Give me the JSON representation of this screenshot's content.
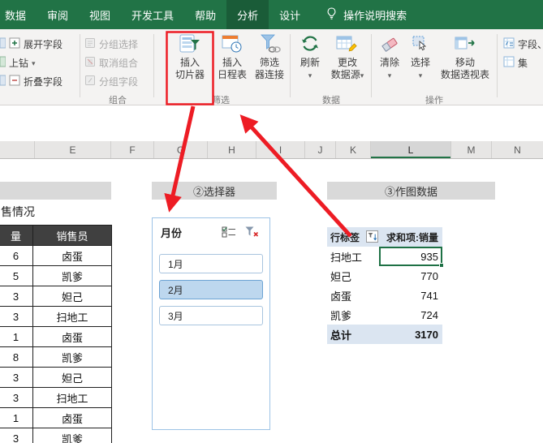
{
  "colors": {
    "excel_green": "#217346",
    "annotation_red": "#ED1C24",
    "slicer_selected_fill": "#BDD7EE",
    "pivot_header_fill": "#DBE5F1"
  },
  "topbar": {
    "tabs": [
      {
        "label": "数据"
      },
      {
        "label": "审阅"
      },
      {
        "label": "视图"
      },
      {
        "label": "开发工具"
      },
      {
        "label": "帮助"
      },
      {
        "label": "分析"
      },
      {
        "label": "设计"
      }
    ],
    "active_tab": "分析",
    "search_label": "操作说明搜索"
  },
  "ribbon": {
    "active_field_group": {
      "expand_label": "展开字段",
      "drill_up_label": "上钻",
      "collapse_label": "折叠字段"
    },
    "group_group": {
      "caption": "组合",
      "items": [
        "分组选择",
        "取消组合",
        "分组字段"
      ]
    },
    "filter_group": {
      "caption": "筛选",
      "insert_slicer": {
        "line1": "插入",
        "line2": "切片器"
      },
      "insert_timeline": {
        "line1": "插入",
        "line2": "日程表"
      },
      "filter_connections": {
        "line1": "筛选",
        "line2": "器连接"
      }
    },
    "data_group": {
      "caption": "数据",
      "refresh_label": "刷新",
      "change_source": {
        "line1": "更改",
        "line2": "数据源"
      }
    },
    "actions_group": {
      "caption": "操作",
      "clear_label": "清除",
      "select_label": "选择",
      "move_pivot": {
        "line1": "移动",
        "line2": "数据透视表"
      }
    },
    "calc_group": {
      "fields_label": "字段、",
      "sets_label": "集"
    }
  },
  "column_headers": {
    "letters": [
      "E",
      "F",
      "G",
      "H",
      "I",
      "J",
      "K",
      "L",
      "M",
      "N"
    ],
    "selected": "L"
  },
  "sheet": {
    "sales_table": {
      "title": "售情况",
      "header_qty": "量",
      "header_person": "销售员",
      "rows": [
        {
          "qty": "6",
          "person": "卤蛋"
        },
        {
          "qty": "5",
          "person": "凯爹"
        },
        {
          "qty": "3",
          "person": "妲己"
        },
        {
          "qty": "3",
          "person": "扫地工"
        },
        {
          "qty": "1",
          "person": "卤蛋"
        },
        {
          "qty": "8",
          "person": "凯爹"
        },
        {
          "qty": "3",
          "person": "妲己"
        },
        {
          "qty": "3",
          "person": "扫地工"
        },
        {
          "qty": "1",
          "person": "卤蛋"
        },
        {
          "qty": "3",
          "person": "凯爹"
        }
      ]
    },
    "selector_section": {
      "caption": "②选择器",
      "slicer": {
        "title": "月份",
        "items": [
          {
            "label": "1月",
            "selected": false
          },
          {
            "label": "2月",
            "selected": true
          },
          {
            "label": "3月",
            "selected": false
          }
        ]
      }
    },
    "chart_section": {
      "caption": "③作图数据",
      "pivot": {
        "row_header": "行标签",
        "value_header": "求和项:销量",
        "rows": [
          {
            "label": "扫地工",
            "value": "935"
          },
          {
            "label": "妲己",
            "value": "770"
          },
          {
            "label": "卤蛋",
            "value": "741"
          },
          {
            "label": "凯爹",
            "value": "724"
          }
        ],
        "total_label": "总计",
        "total_value": "3170",
        "selected_value": "935"
      }
    }
  }
}
